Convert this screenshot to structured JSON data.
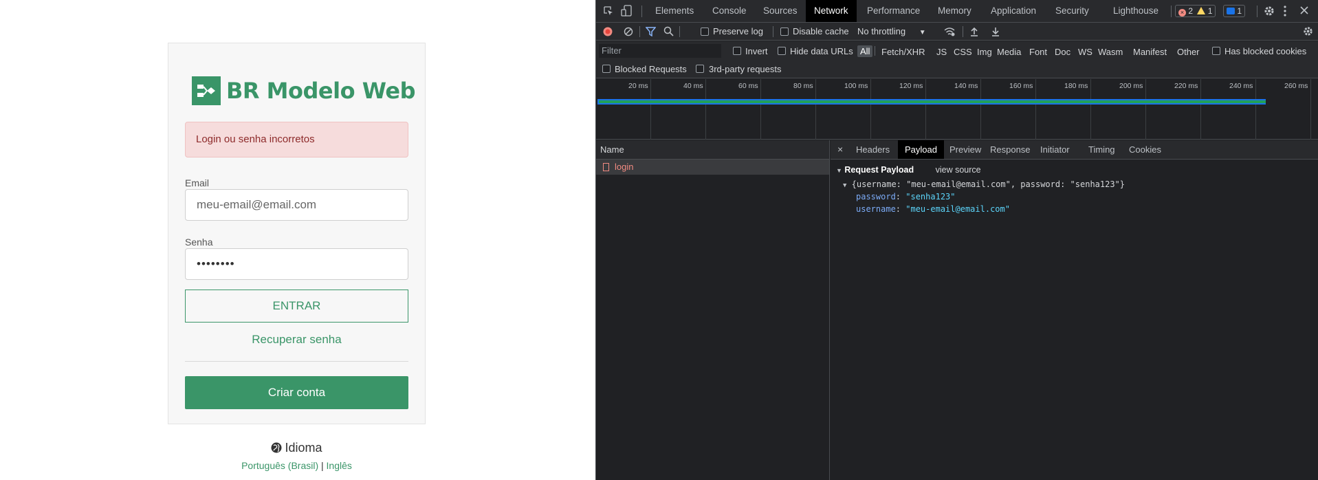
{
  "app": {
    "brand": "BR Modelo Web",
    "alert": "Login ou senha incorretos",
    "email_label": "Email",
    "email_placeholder": "meu-email@email.com",
    "password_label": "Senha",
    "password_value": "••••••••",
    "login_button": "ENTRAR",
    "recover_link": "Recuperar senha",
    "create_button": "Criar conta",
    "language_label": "Idioma",
    "lang_pt": "Português (Brasil)",
    "lang_sep": "|",
    "lang_en": "Inglês",
    "colors": {
      "brand": "#3a9568",
      "alert_bg": "#f6dcdc",
      "alert_text": "#8d2a2a"
    }
  },
  "devtools": {
    "tabs": [
      "Elements",
      "Console",
      "Sources",
      "Network",
      "Performance",
      "Memory",
      "Application",
      "Security",
      "Lighthouse"
    ],
    "active_tab": "Network",
    "errors_count": "2",
    "warnings_count": "1",
    "messages_count": "1",
    "preserve_log": "Preserve log",
    "disable_cache": "Disable cache",
    "throttling": "No throttling",
    "filter_placeholder": "Filter",
    "invert": "Invert",
    "hide_data_urls": "Hide data URLs",
    "filter_types": [
      "All",
      "Fetch/XHR",
      "JS",
      "CSS",
      "Img",
      "Media",
      "Font",
      "Doc",
      "WS",
      "Wasm",
      "Manifest",
      "Other"
    ],
    "has_blocked_cookies": "Has blocked cookies",
    "blocked_requests": "Blocked Requests",
    "third_party": "3rd-party requests",
    "timeline_ticks": [
      "20 ms",
      "40 ms",
      "60 ms",
      "80 ms",
      "100 ms",
      "120 ms",
      "140 ms",
      "160 ms",
      "180 ms",
      "200 ms",
      "220 ms",
      "240 ms",
      "260 ms"
    ],
    "name_header": "Name",
    "request_name": "login",
    "detail_tabs": [
      "Headers",
      "Payload",
      "Preview",
      "Response",
      "Initiator",
      "Timing",
      "Cookies"
    ],
    "active_detail_tab": "Payload",
    "close_symbol": "×",
    "payload_title": "Request Payload",
    "view_source": "view source",
    "payload_summary": "{username: \"meu-email@email.com\", password: \"senha123\"}",
    "payload_fields": [
      {
        "key": "password",
        "value": "\"senha123\""
      },
      {
        "key": "username",
        "value": "\"meu-email@email.com\""
      }
    ]
  }
}
